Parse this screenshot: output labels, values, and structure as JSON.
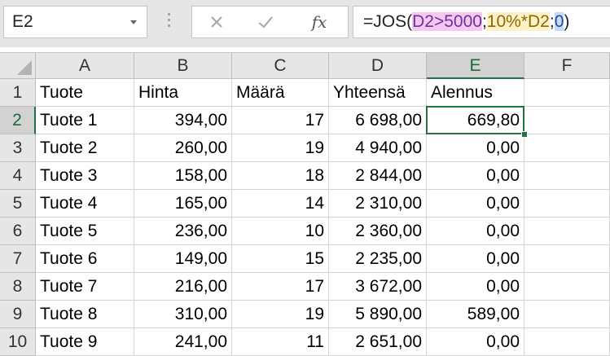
{
  "name_box": {
    "value": "E2"
  },
  "formula_bar": {
    "cancel_icon": "close-icon",
    "enter_icon": "check-icon",
    "fx_label": "fx",
    "formula_parts": [
      {
        "text": "=JOS(",
        "style": "plain"
      },
      {
        "text": "D2>5000",
        "style": "ref1"
      },
      {
        "text": ";",
        "style": "plain"
      },
      {
        "text": "10%*D2",
        "style": "ref2"
      },
      {
        "text": ";",
        "style": "plain"
      },
      {
        "text": "0",
        "style": "ref3"
      },
      {
        "text": ")",
        "style": "plain"
      }
    ]
  },
  "colors": {
    "accent": "#217346",
    "ref1": "#f4c8ef",
    "ref2": "#fff0c8",
    "ref3": "#c9d8f4"
  },
  "sheet": {
    "selected_cell": "E2",
    "column_headers": [
      "A",
      "B",
      "C",
      "D",
      "E",
      "F"
    ],
    "row_headers": [
      "1",
      "2",
      "3",
      "4",
      "5",
      "6",
      "7",
      "8",
      "9",
      "10"
    ],
    "rows": [
      [
        "Tuote",
        "Hinta",
        "Määrä",
        "Yhteensä",
        "Alennus",
        ""
      ],
      [
        "Tuote 1",
        "394,00",
        "17",
        "6 698,00",
        "669,80",
        ""
      ],
      [
        "Tuote 2",
        "260,00",
        "19",
        "4 940,00",
        "0,00",
        ""
      ],
      [
        "Tuote 3",
        "158,00",
        "18",
        "2 844,00",
        "0,00",
        ""
      ],
      [
        "Tuote 4",
        "165,00",
        "14",
        "2 310,00",
        "0,00",
        ""
      ],
      [
        "Tuote 5",
        "236,00",
        "10",
        "2 360,00",
        "0,00",
        ""
      ],
      [
        "Tuote 6",
        "149,00",
        "15",
        "2 235,00",
        "0,00",
        ""
      ],
      [
        "Tuote 7",
        "216,00",
        "17",
        "3 672,00",
        "0,00",
        ""
      ],
      [
        "Tuote 8",
        "310,00",
        "19",
        "5 890,00",
        "589,00",
        ""
      ],
      [
        "Tuote 9",
        "241,00",
        "11",
        "2 651,00",
        "0,00",
        ""
      ]
    ]
  }
}
